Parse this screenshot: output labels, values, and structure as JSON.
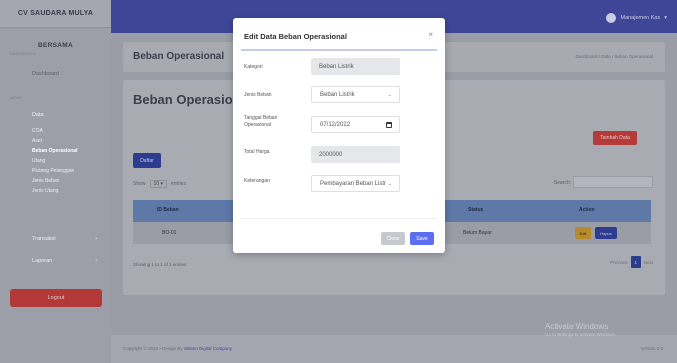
{
  "sidebar": {
    "company": "CV SAUDARA MULYA",
    "title": "BERSAMA",
    "subtitle": "DASHBOARD",
    "dashboard": "Dashboard",
    "section_menu": "MENU",
    "data": "Data",
    "data_items": [
      "COA",
      "Aset",
      "Beban Operasional",
      "Utang",
      "Piutang Pelanggan",
      "Jenis Beban",
      "Jenis Utang"
    ],
    "transaksi": "Transaksi",
    "laporan": "Laporan",
    "logout": "Logout"
  },
  "topbar": {
    "user": "Manajemen Kas"
  },
  "header": {
    "title": "Beban Operasional",
    "breadcrumb": "Dashboard / Data / Beban Operasional"
  },
  "content": {
    "title": "Beban Operasional",
    "cetak_button": "Tambah Data",
    "daftar_button": "Daftar",
    "show_label": "Show",
    "show_value": "10",
    "entries_label": "entries",
    "search_label": "Search:",
    "columns": [
      "ID Beban",
      "Status",
      "Action"
    ],
    "rows": [
      {
        "id": "BO-01",
        "status": "Belum Bayar",
        "edit": "Edit",
        "delete": "Hapus"
      }
    ],
    "showing": "Showing 1 to 1 of 1 entries",
    "prev": "Previous",
    "page": "1",
    "next": "Next"
  },
  "footer": {
    "copyright": "Copyright © 2022 • Design By",
    "link": "Sistem Digital Company",
    "version": "Version 2.0"
  },
  "windows": {
    "activate": "Activate Windows",
    "activate_sub": "Go to Settings to activate Windows."
  },
  "modal": {
    "title": "Edit Data Beban Operasional",
    "close_icon": "×",
    "fields": {
      "kategori": {
        "label": "Kategori",
        "value": "Beban Listrik"
      },
      "jenis": {
        "label": "Jenis Beban",
        "value": "Beban Listrik"
      },
      "tanggal": {
        "label": "Tanggal Beban Operasional",
        "value": "07/12/2022"
      },
      "harga": {
        "label": "Total Harga",
        "value": "2000000"
      },
      "ket": {
        "label": "Keterangan",
        "value": "Pembayaran Beban Listr"
      }
    },
    "close_button": "Close",
    "save_button": "Save"
  },
  "colors": {
    "topbar": "#3f4697",
    "primary": "#5b6ff0",
    "danger": "#b53a3a"
  }
}
